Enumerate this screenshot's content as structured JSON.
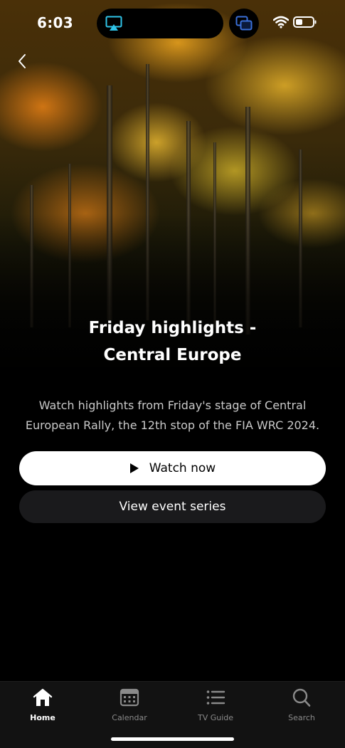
{
  "status_bar": {
    "time": "6:03",
    "icons": [
      "airplay-icon",
      "picture-in-picture-icon",
      "wifi-icon",
      "battery-icon"
    ]
  },
  "hero": {
    "title_line1": "Friday highlights -",
    "title_line2": "Central Europe",
    "description": "Watch highlights from Friday's stage of Central European Rally, the 12th stop of the FIA WRC 2024."
  },
  "actions": {
    "watch_label": "Watch now",
    "series_label": "View event series"
  },
  "tab_bar": {
    "items": [
      {
        "label": "Home",
        "icon": "home-icon",
        "active": true
      },
      {
        "label": "Calendar",
        "icon": "calendar-icon",
        "active": false
      },
      {
        "label": "TV Guide",
        "icon": "list-icon",
        "active": false
      },
      {
        "label": "Search",
        "icon": "search-icon",
        "active": false
      }
    ]
  },
  "colors": {
    "background": "#000000",
    "primary_button": "#ffffff",
    "secondary_button": "#1a1a1c",
    "tab_inactive": "#8a8a8a",
    "airplay_accent": "#2fc4e8"
  }
}
